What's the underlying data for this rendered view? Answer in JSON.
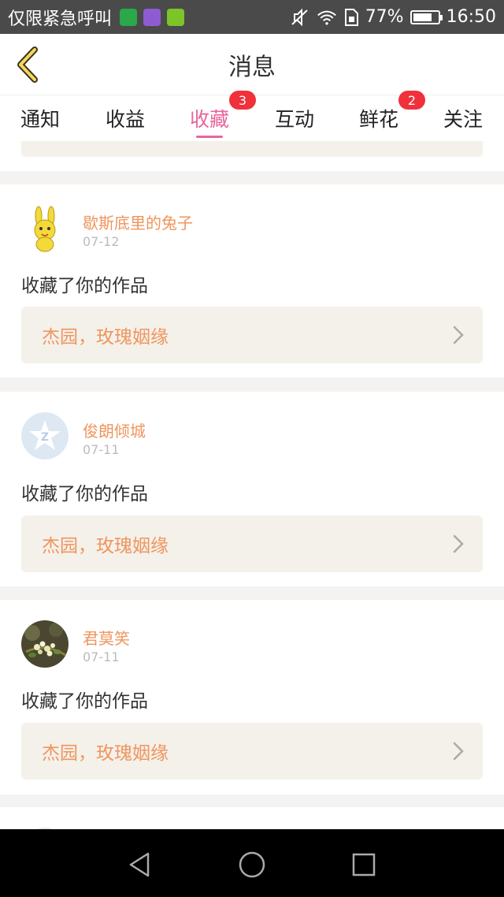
{
  "status_bar": {
    "carrier": "仅限紧急呼叫",
    "battery_percent": "77%",
    "battery_level": 0.77,
    "time": "16:50",
    "icons": [
      "sim-app-icon",
      "gallery-app-icon",
      "shield-app-icon",
      "mute-icon",
      "wifi-icon",
      "sim-card-icon",
      "battery-icon"
    ]
  },
  "header": {
    "title": "消息",
    "back_icon": "chevron-left-icon"
  },
  "tabs": [
    {
      "label": "通知",
      "badge": ""
    },
    {
      "label": "收益",
      "badge": ""
    },
    {
      "label": "收藏",
      "badge": "3",
      "active": true
    },
    {
      "label": "互动",
      "badge": ""
    },
    {
      "label": "鲜花",
      "badge": "2"
    },
    {
      "label": "关注",
      "badge": ""
    }
  ],
  "items": [
    {
      "user": "歇斯底里的兔子",
      "date": "07-12",
      "action": "收藏了你的作品",
      "work": "杰园，玫瑰姻缘",
      "avatar": "rabbit-avatar"
    },
    {
      "user": "俊朗倾城",
      "date": "07-11",
      "action": "收藏了你的作品",
      "work": "杰园，玫瑰姻缘",
      "avatar": "default-star-avatar"
    },
    {
      "user": "君莫笑",
      "date": "07-11",
      "action": "收藏了你的作品",
      "work": "杰园，玫瑰姻缘",
      "avatar": "flower-photo-avatar"
    }
  ],
  "colors": {
    "accent_pink": "#e8659d",
    "name_orange": "#f0955e",
    "badge_red": "#f0303a",
    "card_bg": "#f4f1ea"
  },
  "nav": [
    "back-triangle-icon",
    "home-circle-icon",
    "recents-square-icon"
  ]
}
